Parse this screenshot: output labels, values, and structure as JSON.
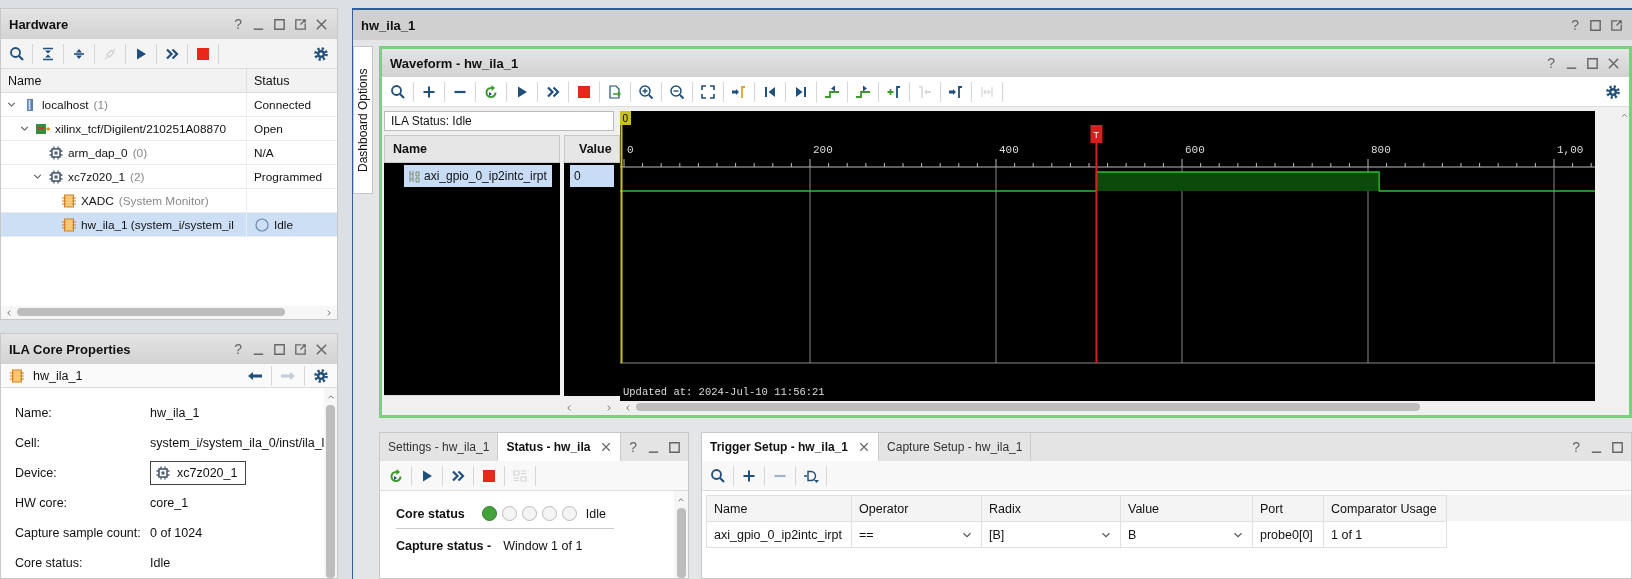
{
  "hardware": {
    "title": "Hardware",
    "help": "?",
    "toolbar": [
      {
        "kind": "search",
        "disabled": false
      },
      {
        "kind": "collapse-all",
        "disabled": false
      },
      {
        "kind": "expand-all",
        "disabled": false
      },
      {
        "kind": "plug",
        "disabled": true
      },
      {
        "kind": "play",
        "disabled": false
      },
      {
        "kind": "fast-forward",
        "disabled": false
      },
      {
        "kind": "stop",
        "disabled": false
      }
    ],
    "columns": [
      "Name",
      "Status"
    ],
    "tree": [
      {
        "kind": "host",
        "name": "localhost",
        "detail": "(1)",
        "status": "Connected",
        "idle_dot": false,
        "expanded": true,
        "selected": false,
        "children": [
          {
            "kind": "board",
            "name": "xilinx_tcf/Digilent/210251A08870",
            "status": "Open",
            "idle_dot": false,
            "expanded": true,
            "selected": false,
            "children": [
              {
                "kind": "device",
                "name": "arm_dap_0",
                "detail": "(0)",
                "status": "N/A",
                "idle_dot": false,
                "selected": false
              },
              {
                "kind": "device",
                "name": "xc7z020_1",
                "detail": "(2)",
                "status": "Programmed",
                "idle_dot": false,
                "expanded": true,
                "selected": false,
                "children": [
                  {
                    "kind": "core",
                    "name": "XADC",
                    "detail": "(System Monitor)",
                    "idle_dot": false,
                    "selected": false
                  },
                  {
                    "kind": "core",
                    "name": "hw_ila_1 (system_i/system_il",
                    "status": "Idle",
                    "idle_dot": true,
                    "selected": true
                  }
                ]
              }
            ]
          }
        ]
      }
    ]
  },
  "properties": {
    "title": "ILA Core Properties",
    "help": "?",
    "object": {
      "name": "hw_ila_1"
    },
    "nav": [
      {
        "kind": "back",
        "disabled": false
      },
      {
        "kind": "forward",
        "disabled": true
      }
    ],
    "rows": [
      {
        "label": "Name:",
        "value": "hw_ila_1",
        "kind": "text"
      },
      {
        "label": "Cell:",
        "value": "system_i/system_ila_0/inst/ila_l",
        "kind": "text"
      },
      {
        "label": "Device:",
        "value": "xc7z020_1",
        "kind": "device"
      },
      {
        "label": "HW core:",
        "value": "core_1",
        "kind": "text"
      },
      {
        "label": "Capture sample count:",
        "value": "0 of 1024",
        "kind": "text"
      },
      {
        "label": "Core status:",
        "value": "Idle",
        "kind": "text"
      }
    ]
  },
  "dashboard": {
    "title": "hw_ila_1",
    "help": "?",
    "side_tab": "Dashboard Options",
    "waveform": {
      "title": "Waveform - hw_ila_1",
      "help": "?",
      "toolbar": [
        {
          "kind": "search",
          "disabled": false
        },
        {
          "kind": "plus",
          "disabled": false
        },
        {
          "kind": "minus",
          "disabled": false
        },
        {
          "kind": "refresh",
          "disabled": false
        },
        {
          "kind": "play",
          "disabled": false
        },
        {
          "kind": "fast-forward",
          "disabled": false
        },
        {
          "kind": "stop",
          "disabled": false
        },
        {
          "kind": "export",
          "disabled": false
        },
        {
          "kind": "zoom-in",
          "disabled": false
        },
        {
          "kind": "zoom-out",
          "disabled": false
        },
        {
          "kind": "fit",
          "disabled": false
        },
        {
          "kind": "cursor-to-zero",
          "disabled": false
        },
        {
          "kind": "go-first",
          "disabled": false
        },
        {
          "kind": "go-last",
          "disabled": false
        },
        {
          "kind": "prev-edge",
          "disabled": false
        },
        {
          "kind": "next-edge",
          "disabled": false
        },
        {
          "kind": "add-marker",
          "disabled": false
        },
        {
          "kind": "prev-marker",
          "disabled": true
        },
        {
          "kind": "next-marker",
          "disabled": false
        },
        {
          "kind": "stretch",
          "disabled": true
        }
      ],
      "ila_status": "ILA Status: Idle",
      "columns": [
        "Name",
        "Value"
      ],
      "signals": [
        {
          "name": "axi_gpio_0_ip2intc_irpt",
          "value": "0",
          "selected": true
        }
      ],
      "cursor_label": "0",
      "trigger_label": "T",
      "ticks": [
        "0",
        "200",
        "400",
        "600",
        "800",
        "1,00"
      ],
      "updated": "Updated at: 2024-Jul-10 11:56:21"
    }
  },
  "status_panel": {
    "tabs": [
      {
        "label": "Settings - hw_ila_1",
        "selected": false,
        "closable": false
      },
      {
        "label": "Status - hw_ila",
        "selected": true,
        "closable": true
      }
    ],
    "help": "?",
    "toolbar": [
      {
        "kind": "refresh",
        "disabled": false
      },
      {
        "kind": "play",
        "disabled": false
      },
      {
        "kind": "fast-forward",
        "disabled": false
      },
      {
        "kind": "stop",
        "disabled": false
      },
      {
        "kind": "layout",
        "disabled": true
      }
    ],
    "core_status": {
      "label": "Core status",
      "steps": [
        {
          "on": true
        },
        {
          "on": false
        },
        {
          "on": false
        },
        {
          "on": false
        },
        {
          "on": false
        }
      ],
      "value": "Idle"
    },
    "capture_status": {
      "label": "Capture status -",
      "value": "Window 1 of 1"
    }
  },
  "trigger_panel": {
    "tabs": [
      {
        "label": "Trigger Setup - hw_ila_1",
        "selected": true,
        "closable": true
      },
      {
        "label": "Capture Setup - hw_ila_1",
        "selected": false,
        "closable": false
      }
    ],
    "help": "?",
    "toolbar": [
      {
        "kind": "search",
        "disabled": false
      },
      {
        "kind": "plus",
        "disabled": false
      },
      {
        "kind": "minus",
        "disabled": true
      },
      {
        "kind": "gate",
        "disabled": false
      }
    ],
    "columns": [
      "Name",
      "Operator",
      "Radix",
      "Value",
      "Port",
      "Comparator Usage"
    ],
    "rows": [
      {
        "name": "axi_gpio_0_ip2intc_irpt",
        "operator": "==",
        "radix": "[B]",
        "value": "B",
        "port": "probe0[0]",
        "usage": "1 of 1"
      }
    ]
  }
}
